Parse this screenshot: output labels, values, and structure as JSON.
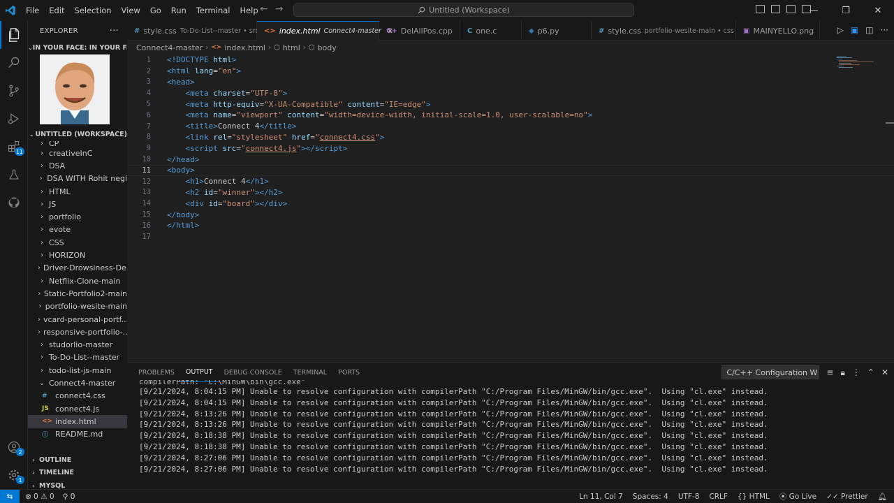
{
  "window": {
    "title": "Untitled (Workspace)",
    "menu": [
      "File",
      "Edit",
      "Selection",
      "View",
      "Go",
      "Run",
      "Terminal",
      "Help"
    ]
  },
  "sidebar": {
    "header": "EXPLORER",
    "profile_section": "IN YOUR FACE: IN YOUR F...",
    "workspace_section": "UNTITLED (WORKSPACE)",
    "partial_item": "CP",
    "folders": [
      "creativeInC",
      "DSA",
      "DSA WITH Rohit negi",
      "HTML",
      "JS",
      "portfolio",
      "evote",
      "CSS",
      "HORIZON",
      "Driver-Drowsiness-De...",
      "Netflix-Clone-main",
      "Static-Portfolio2-main",
      "portfolio-wesite-main",
      "vcard-personal-portf...",
      "responsive-portfolio-...",
      "studorlio-master",
      "To-Do-List--master",
      "todo-list-js-main"
    ],
    "open_folder": "Connect4-master",
    "files": [
      {
        "icon": "#",
        "name": "connect4.css",
        "color": "#519aba"
      },
      {
        "icon": "JS",
        "name": "connect4.js",
        "color": "#cbcb41"
      },
      {
        "icon": "<>",
        "name": "index.html",
        "color": "#e37933"
      },
      {
        "icon": "ⓘ",
        "name": "README.md",
        "color": "#519aba"
      }
    ],
    "outline": "OUTLINE",
    "timeline": "TIMELINE",
    "mysql": "MYSQL"
  },
  "tabs": [
    {
      "icon": "#",
      "icon_color": "#519aba",
      "name": "style.css",
      "desc": "To-Do-List--master • src"
    },
    {
      "icon": "<>",
      "icon_color": "#e37933",
      "name": "index.html",
      "desc": "Connect4-master",
      "active": true
    },
    {
      "icon": "C+",
      "icon_color": "#a074c4",
      "name": "DelAllPos.cpp",
      "desc": ""
    },
    {
      "icon": "C",
      "icon_color": "#519aba",
      "name": "one.c",
      "desc": ""
    },
    {
      "icon": "◆",
      "icon_color": "#3572a5",
      "name": "p6.py",
      "desc": ""
    },
    {
      "icon": "#",
      "icon_color": "#519aba",
      "name": "style.css",
      "desc": "portfolio-wesite-main • css"
    },
    {
      "icon": "▣",
      "icon_color": "#a074c4",
      "name": "MAINYELLO.png",
      "desc": ""
    }
  ],
  "breadcrumb": [
    "Connect4-master",
    "index.html",
    "html",
    "body"
  ],
  "editor": {
    "line_numbers": [
      "1",
      "2",
      "3",
      "4",
      "5",
      "6",
      "7",
      "8",
      "9",
      "10",
      "11",
      "12",
      "13",
      "14",
      "15",
      "16",
      "17"
    ],
    "current_line": "11"
  },
  "panel": {
    "tabs": [
      "PROBLEMS",
      "OUTPUT",
      "DEBUG CONSOLE",
      "TERMINAL",
      "PORTS"
    ],
    "channel": "C/C++ Configuration W",
    "partial_line": "compilerPath: \"C:\\MinGW\\bin\\gcc.exe\"",
    "log_lines": [
      "[9/21/2024, 8:04:15 PM] Unable to resolve configuration with compilerPath \"C:/Program Files/MinGW/bin/gcc.exe\".  Using \"cl.exe\" instead.",
      "[9/21/2024, 8:04:15 PM] Unable to resolve configuration with compilerPath \"C:/Program Files/MinGW/bin/gcc.exe\".  Using \"cl.exe\" instead.",
      "[9/21/2024, 8:13:26 PM] Unable to resolve configuration with compilerPath \"C:/Program Files/MinGW/bin/gcc.exe\".  Using \"cl.exe\" instead.",
      "[9/21/2024, 8:13:26 PM] Unable to resolve configuration with compilerPath \"C:/Program Files/MinGW/bin/gcc.exe\".  Using \"cl.exe\" instead.",
      "[9/21/2024, 8:18:38 PM] Unable to resolve configuration with compilerPath \"C:/Program Files/MinGW/bin/gcc.exe\".  Using \"cl.exe\" instead.",
      "[9/21/2024, 8:18:38 PM] Unable to resolve configuration with compilerPath \"C:/Program Files/MinGW/bin/gcc.exe\".  Using \"cl.exe\" instead.",
      "[9/21/2024, 8:27:06 PM] Unable to resolve configuration with compilerPath \"C:/Program Files/MinGW/bin/gcc.exe\".  Using \"cl.exe\" instead.",
      "[9/21/2024, 8:27:06 PM] Unable to resolve configuration with compilerPath \"C:/Program Files/MinGW/bin/gcc.exe\".  Using \"cl.exe\" instead."
    ]
  },
  "statusbar": {
    "errors": "0",
    "warnings": "0",
    "ports": "0",
    "position": "Ln 11, Col 7",
    "spaces": "Spaces: 4",
    "encoding": "UTF-8",
    "eol": "CRLF",
    "language": "HTML",
    "golive": "Go Live",
    "prettier": "Prettier"
  },
  "badges": {
    "extensions": "11",
    "accounts": "2",
    "manage": "1"
  },
  "colors": {
    "accent": "#0078d4",
    "tag": "#569cd6",
    "attr": "#9cdcfe",
    "string": "#ce9178"
  }
}
